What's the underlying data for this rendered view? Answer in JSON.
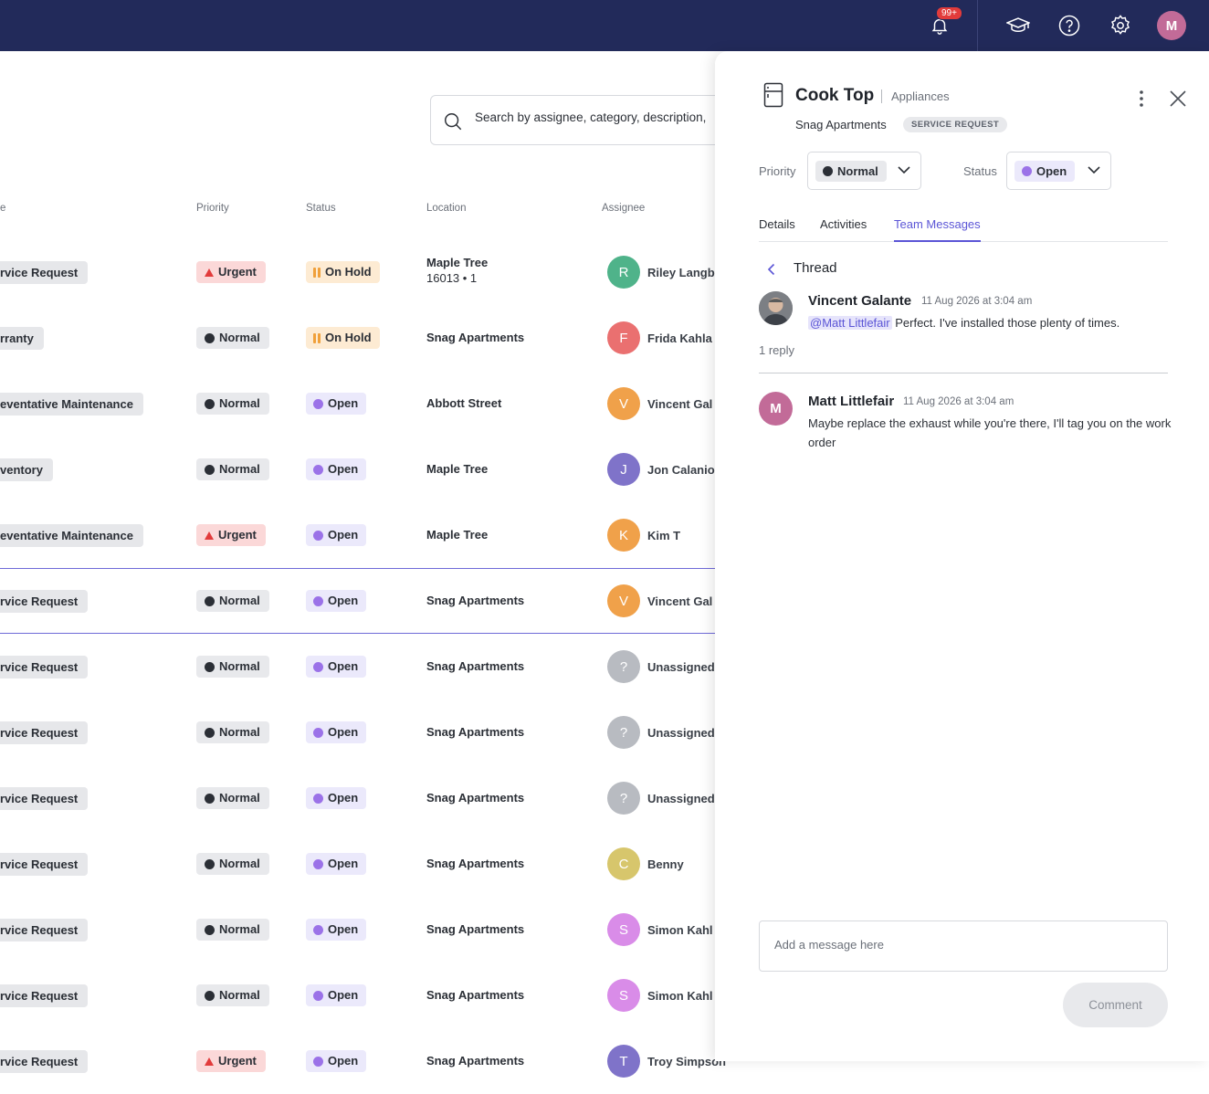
{
  "topbar": {
    "notif_badge": "99+",
    "user_initial": "M"
  },
  "search": {
    "placeholder": "Search by assignee, category, description,"
  },
  "columns": {
    "priority": "Priority",
    "status": "Status",
    "location": "Location",
    "assignee": "Assignee"
  },
  "rows": [
    {
      "type": "rvice Request",
      "priority": "Urgent",
      "status": "On Hold",
      "location": "Maple Tree",
      "location_sub": "16013 • 1",
      "initial": "R",
      "assignee": "Riley Langbe",
      "avatar_color": "#4fb38a"
    },
    {
      "type": "rranty",
      "priority": "Normal",
      "status": "On Hold",
      "location": "Snag Apartments",
      "initial": "F",
      "assignee": "Frida Kahla",
      "avatar_color": "#ea7070"
    },
    {
      "type": "eventative Maintenance",
      "priority": "Normal",
      "status": "Open",
      "location": "Abbott Street",
      "initial": "V",
      "assignee": "Vincent Gal",
      "avatar_color": "#f0a14a"
    },
    {
      "type": "ventory",
      "priority": "Normal",
      "status": "Open",
      "location": "Maple Tree",
      "initial": "J",
      "assignee": "Jon Calanio",
      "avatar_color": "#7f73c9"
    },
    {
      "type": "eventative Maintenance",
      "priority": "Urgent",
      "status": "Open",
      "location": "Maple Tree",
      "initial": "K",
      "assignee": "Kim T",
      "avatar_color": "#f0a14a"
    },
    {
      "type": "rvice Request",
      "priority": "Normal",
      "status": "Open",
      "location": "Snag Apartments",
      "initial": "V",
      "assignee": "Vincent Gal",
      "avatar_color": "#f0a14a"
    },
    {
      "type": "rvice Request",
      "priority": "Normal",
      "status": "Open",
      "location": "Snag Apartments",
      "initial": "?",
      "assignee": "Unassigned",
      "avatar_color": "#b8bbc1"
    },
    {
      "type": "rvice Request",
      "priority": "Normal",
      "status": "Open",
      "location": "Snag Apartments",
      "initial": "?",
      "assignee": "Unassigned",
      "avatar_color": "#b8bbc1"
    },
    {
      "type": "rvice Request",
      "priority": "Normal",
      "status": "Open",
      "location": "Snag Apartments",
      "initial": "?",
      "assignee": "Unassigned",
      "avatar_color": "#b8bbc1"
    },
    {
      "type": "rvice Request",
      "priority": "Normal",
      "status": "Open",
      "location": "Snag Apartments",
      "initial": "C",
      "assignee": "Benny",
      "avatar_color": "#d7c66c"
    },
    {
      "type": "rvice Request",
      "priority": "Normal",
      "status": "Open",
      "location": "Snag Apartments",
      "initial": "S",
      "assignee": "Simon Kahl",
      "avatar_color": "#d98ce8"
    },
    {
      "type": "rvice Request",
      "priority": "Normal",
      "status": "Open",
      "location": "Snag Apartments",
      "initial": "S",
      "assignee": "Simon Kahl",
      "avatar_color": "#d98ce8"
    },
    {
      "type": "rvice Request",
      "priority": "Urgent",
      "status": "Open",
      "location": "Snag Apartments",
      "initial": "T",
      "assignee": "Troy Simpson",
      "avatar_color": "#7f73c9"
    }
  ],
  "panel": {
    "title": "Cook Top",
    "category": "Appliances",
    "site": "Snag Apartments",
    "tag": "SERVICE REQUEST",
    "priority_label": "Priority",
    "priority_value": "Normal",
    "status_label": "Status",
    "status_value": "Open",
    "tabs": [
      "Details",
      "Activities",
      "Team Messages"
    ],
    "thread_title": "Thread",
    "messages": [
      {
        "author": "Vincent Galante",
        "time": "11 Aug 2026 at 3:04 am",
        "mention": "@Matt Littlefair",
        "text": " Perfect. I've installed those plenty of times."
      },
      {
        "author": "Matt Littlefair",
        "initial": "M",
        "time": "11 Aug 2026 at 3:04 am",
        "text": "Maybe replace the exhaust while you're there, I'll tag you on the work order"
      }
    ],
    "replies": "1 reply",
    "input_placeholder": "Add a message here",
    "comment_label": "Comment"
  },
  "colors": {
    "accent": "#5b55d6",
    "topbar": "#222a5a",
    "urgent": "#e23b3b",
    "open_dot": "#9b72e8",
    "hold": "#f0a03a"
  }
}
